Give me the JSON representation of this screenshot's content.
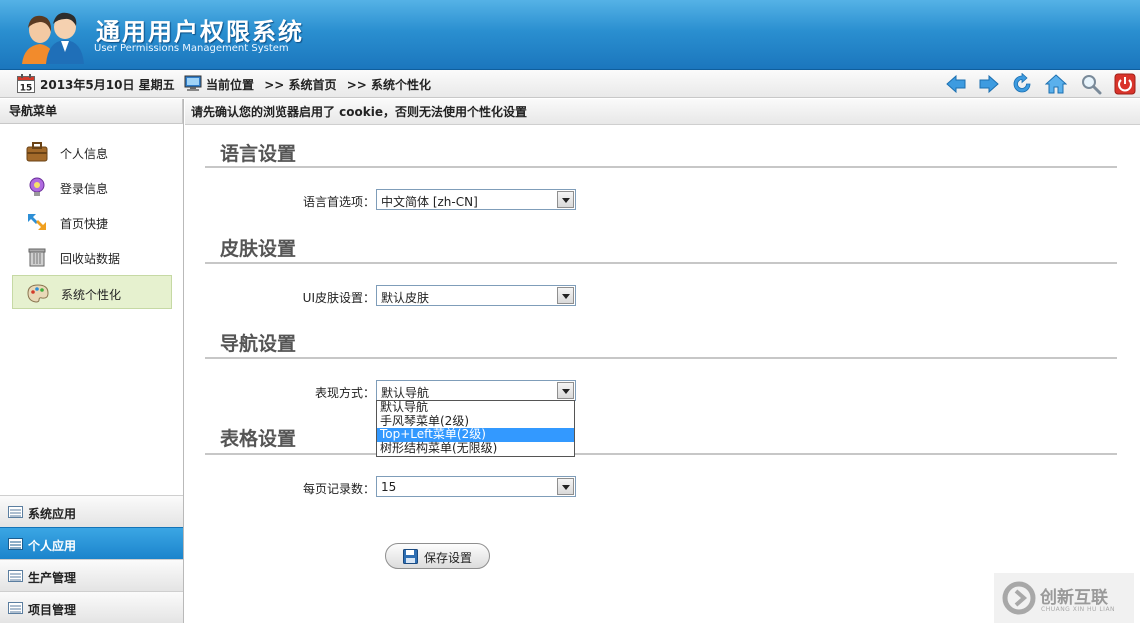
{
  "header": {
    "title": "通用用户权限系统",
    "subtitle": "User Permissions Management System"
  },
  "toolbar": {
    "date": "2013年5月10日 星期五",
    "calendar_day": "15",
    "breadcrumb": [
      "当前位置",
      ">> 系统首页",
      ">> 系统个性化"
    ],
    "icons": [
      "back-arrow-icon",
      "forward-arrow-icon",
      "refresh-icon",
      "home-icon",
      "search-icon",
      "power-icon"
    ]
  },
  "sidebar": {
    "title": "导航菜单",
    "items": [
      {
        "label": "个人信息",
        "icon": "briefcase-icon"
      },
      {
        "label": "登录信息",
        "icon": "lightbulb-icon"
      },
      {
        "label": "首页快捷",
        "icon": "shortcut-arrows-icon"
      },
      {
        "label": "回收站数据",
        "icon": "trash-bin-icon"
      },
      {
        "label": "系统个性化",
        "icon": "palette-icon",
        "active": true
      }
    ],
    "accordion": [
      {
        "label": "系统应用"
      },
      {
        "label": "个人应用",
        "active": true
      },
      {
        "label": "生产管理"
      },
      {
        "label": "项目管理"
      }
    ]
  },
  "main": {
    "notice": "请先确认您的浏览器启用了 cookie，否则无法使用个性化设置",
    "sections": {
      "language": {
        "title": "语言设置",
        "label": "语言首选项：",
        "value": "中文简体 [zh-CN]"
      },
      "skin": {
        "title": "皮肤设置",
        "label": "UI皮肤设置：",
        "value": "默认皮肤"
      },
      "navigation": {
        "title": "导航设置",
        "label": "表现方式：",
        "value": "默认导航",
        "options": [
          "默认导航",
          "手风琴菜单(2级)",
          "Top+Left菜单(2级)",
          "树形结构菜单(无限级)"
        ],
        "highlighted_index": 2
      },
      "table": {
        "title": "表格设置",
        "label": "每页记录数：",
        "value": "15"
      }
    },
    "save_label": "保存设置"
  },
  "watermark": {
    "text": "创新互联",
    "sub": "CHUANG XIN HU LIAN"
  },
  "colors": {
    "header_blue": "#2a8fd0",
    "active_accordion": "#1b84cc",
    "active_menu_bg": "#e6f1cf",
    "dropdown_highlight": "#3399ff"
  }
}
